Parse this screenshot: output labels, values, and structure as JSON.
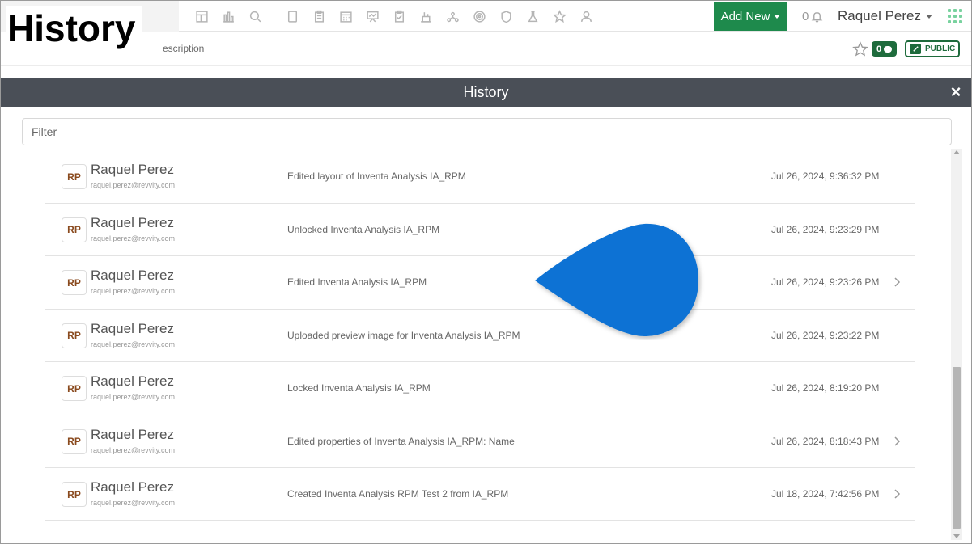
{
  "overlay_title": "History",
  "topbar": {
    "add_new_label": "Add New",
    "notification_count": "0",
    "user_name": "Raquel Perez",
    "nav_icons": [
      "dashboard-icon",
      "chart-icon",
      "search-icon",
      "notebook-icon",
      "clipboard-icon",
      "calendar-icon",
      "presentation-icon",
      "checklist-icon",
      "lab-icon",
      "network-icon",
      "target-icon",
      "shield-icon",
      "flask-icon",
      "star-icon",
      "users-icon"
    ]
  },
  "subbar": {
    "text": "escription",
    "comments_count": "0",
    "visibility_label": "PUBLIC"
  },
  "modal": {
    "title": "History",
    "close_symbol": "×",
    "filter_placeholder": "Filter",
    "rows": [
      {
        "initials": "RP",
        "name": "Raquel Perez",
        "email": "raquel.perez@revvity.com",
        "action": "Edited layout of Inventa Analysis IA_RPM",
        "time": "Jul 26, 2024, 9:36:32 PM",
        "has_details": false
      },
      {
        "initials": "RP",
        "name": "Raquel Perez",
        "email": "raquel.perez@revvity.com",
        "action": "Unlocked Inventa Analysis IA_RPM",
        "time": "Jul 26, 2024, 9:23:29 PM",
        "has_details": false
      },
      {
        "initials": "RP",
        "name": "Raquel Perez",
        "email": "raquel.perez@revvity.com",
        "action": "Edited Inventa Analysis IA_RPM",
        "time": "Jul 26, 2024, 9:23:26 PM",
        "has_details": true
      },
      {
        "initials": "RP",
        "name": "Raquel Perez",
        "email": "raquel.perez@revvity.com",
        "action": "Uploaded preview image for Inventa Analysis IA_RPM",
        "time": "Jul 26, 2024, 9:23:22 PM",
        "has_details": false
      },
      {
        "initials": "RP",
        "name": "Raquel Perez",
        "email": "raquel.perez@revvity.com",
        "action": "Locked Inventa Analysis IA_RPM",
        "time": "Jul 26, 2024, 8:19:20 PM",
        "has_details": false
      },
      {
        "initials": "RP",
        "name": "Raquel Perez",
        "email": "raquel.perez@revvity.com",
        "action": "Edited properties of Inventa Analysis IA_RPM: Name",
        "time": "Jul 26, 2024, 8:18:43 PM",
        "has_details": true
      },
      {
        "initials": "RP",
        "name": "Raquel Perez",
        "email": "raquel.perez@revvity.com",
        "action": "Created Inventa Analysis RPM Test 2 from IA_RPM",
        "time": "Jul 18, 2024, 7:42:56 PM",
        "has_details": true
      }
    ]
  },
  "colors": {
    "brand_green": "#1e8a4c",
    "modal_header": "#4a4f57",
    "pointer_blue": "#0a72d4"
  }
}
